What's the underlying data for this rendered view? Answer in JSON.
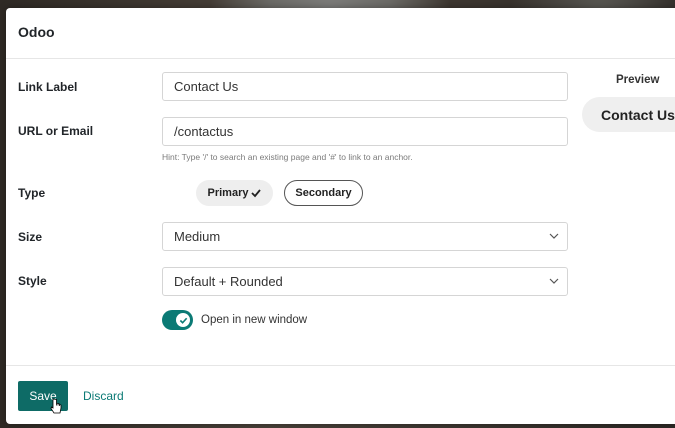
{
  "dialog": {
    "title": "Odoo"
  },
  "form": {
    "link_label": {
      "label": "Link Label",
      "value": "Contact Us"
    },
    "url": {
      "label": "URL or Email",
      "value": "/contactus",
      "hint": "Hint: Type '/' to search an existing page and '#' to link to an anchor."
    },
    "type": {
      "label": "Type",
      "options": [
        {
          "label": "Primary",
          "selected": true
        },
        {
          "label": "Secondary",
          "selected": false
        }
      ]
    },
    "size": {
      "label": "Size",
      "value": "Medium"
    },
    "style": {
      "label": "Style",
      "value": "Default + Rounded"
    },
    "new_window": {
      "label": "Open in new window",
      "checked": true
    }
  },
  "preview": {
    "title": "Preview",
    "button_label": "Contact Us"
  },
  "footer": {
    "save_label": "Save",
    "discard_label": "Discard"
  },
  "colors": {
    "accent": "#0b7a75",
    "save": "#0e6b66"
  },
  "icons": {
    "chevron": "chevron-down-icon",
    "check": "check-icon",
    "toggle_check": "check-icon",
    "cursor": "cursor-pointer-icon"
  }
}
